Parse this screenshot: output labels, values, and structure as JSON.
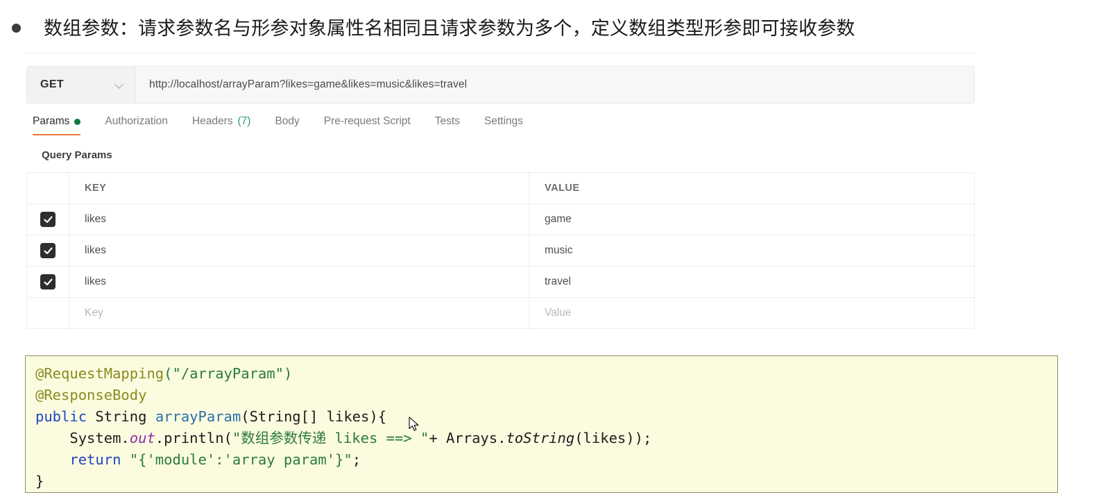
{
  "heading": {
    "bullet_icon": "bullet-dot",
    "text": "数组参数：请求参数名与形参对象属性名相同且请求参数为多个，定义数组类型形参即可接收参数"
  },
  "request_bar": {
    "method": "GET",
    "method_dropdown_icon": "chevron-down-icon",
    "url": "http://localhost/arrayParam?likes=game&likes=music&likes=travel"
  },
  "tabs": [
    {
      "label": "Params",
      "active": true,
      "dot": true
    },
    {
      "label": "Authorization",
      "active": false
    },
    {
      "label": "Headers",
      "count": "(7)",
      "active": false
    },
    {
      "label": "Body",
      "active": false
    },
    {
      "label": "Pre-request Script",
      "active": false
    },
    {
      "label": "Tests",
      "active": false
    },
    {
      "label": "Settings",
      "active": false
    }
  ],
  "query_params": {
    "section_title": "Query Params",
    "columns": {
      "key": "KEY",
      "value": "VALUE"
    },
    "rows": [
      {
        "checked": true,
        "key": "likes",
        "value": "game"
      },
      {
        "checked": true,
        "key": "likes",
        "value": "music"
      },
      {
        "checked": true,
        "key": "likes",
        "value": "travel"
      }
    ],
    "empty_row": {
      "key_placeholder": "Key",
      "value_placeholder": "Value"
    }
  },
  "code": {
    "line1_anno": "@RequestMapping",
    "line1_paren_open": "(",
    "line1_str": "\"/arrayParam\"",
    "line1_paren_close": ")",
    "line2_anno": "@ResponseBody",
    "line3_kw": "public",
    "line3_type": " String ",
    "line3_method": "arrayParam",
    "line3_sig": "(String[] likes){",
    "line4_indent": "    ",
    "line4_obj": "System.",
    "line4_field": "out",
    "line4_call": ".println(",
    "line4_str": "\"数组参数传递 likes ==> \"",
    "line4_plus": "+ Arrays.",
    "line4_static": "toString",
    "line4_args": "(likes));",
    "line5_indent": "    ",
    "line5_kw": "return",
    "line5_str": " \"{'module':'array param'}\"",
    "line5_semi": ";",
    "line6_close": "}"
  },
  "colors": {
    "accent_underline": "#e8743b",
    "status_dot": "#0b7a44",
    "code_background": "#fbfbe0",
    "code_border": "#8f8f5e",
    "annotation": "#8a8a20",
    "string": "#2a7a3b",
    "keyword": "#1f45c4",
    "method": "#2b6fa8",
    "field": "#8b2fa8",
    "checkbox": "#2e2e2e"
  },
  "cursor": {
    "icon": "mouse-pointer-icon"
  }
}
